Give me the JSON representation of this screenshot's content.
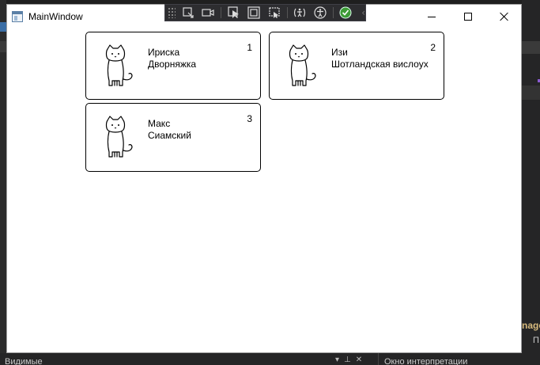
{
  "window": {
    "title": "MainWindow"
  },
  "debug_toolbar": {
    "icons": [
      "select-element-icon",
      "record-icon",
      "pointer-select-icon",
      "display-layout-icon",
      "track-focus-icon",
      "accessibility-checker-icon",
      "accessibility-icon",
      "binding-success-icon",
      "collapse-chevron-icon"
    ]
  },
  "cats": [
    {
      "number": "1",
      "name": "Ириска",
      "breed": "Дворняжка"
    },
    {
      "number": "2",
      "name": "Изи",
      "breed": "Шотландская вислоух"
    },
    {
      "number": "3",
      "name": "Макс",
      "breed": "Сиамский"
    }
  ],
  "ide": {
    "bottom_left_title": "Видимые",
    "bottom_right_title": "Окно интерпретации",
    "right_fragment": "nage",
    "right_fragment_2": "П"
  }
}
